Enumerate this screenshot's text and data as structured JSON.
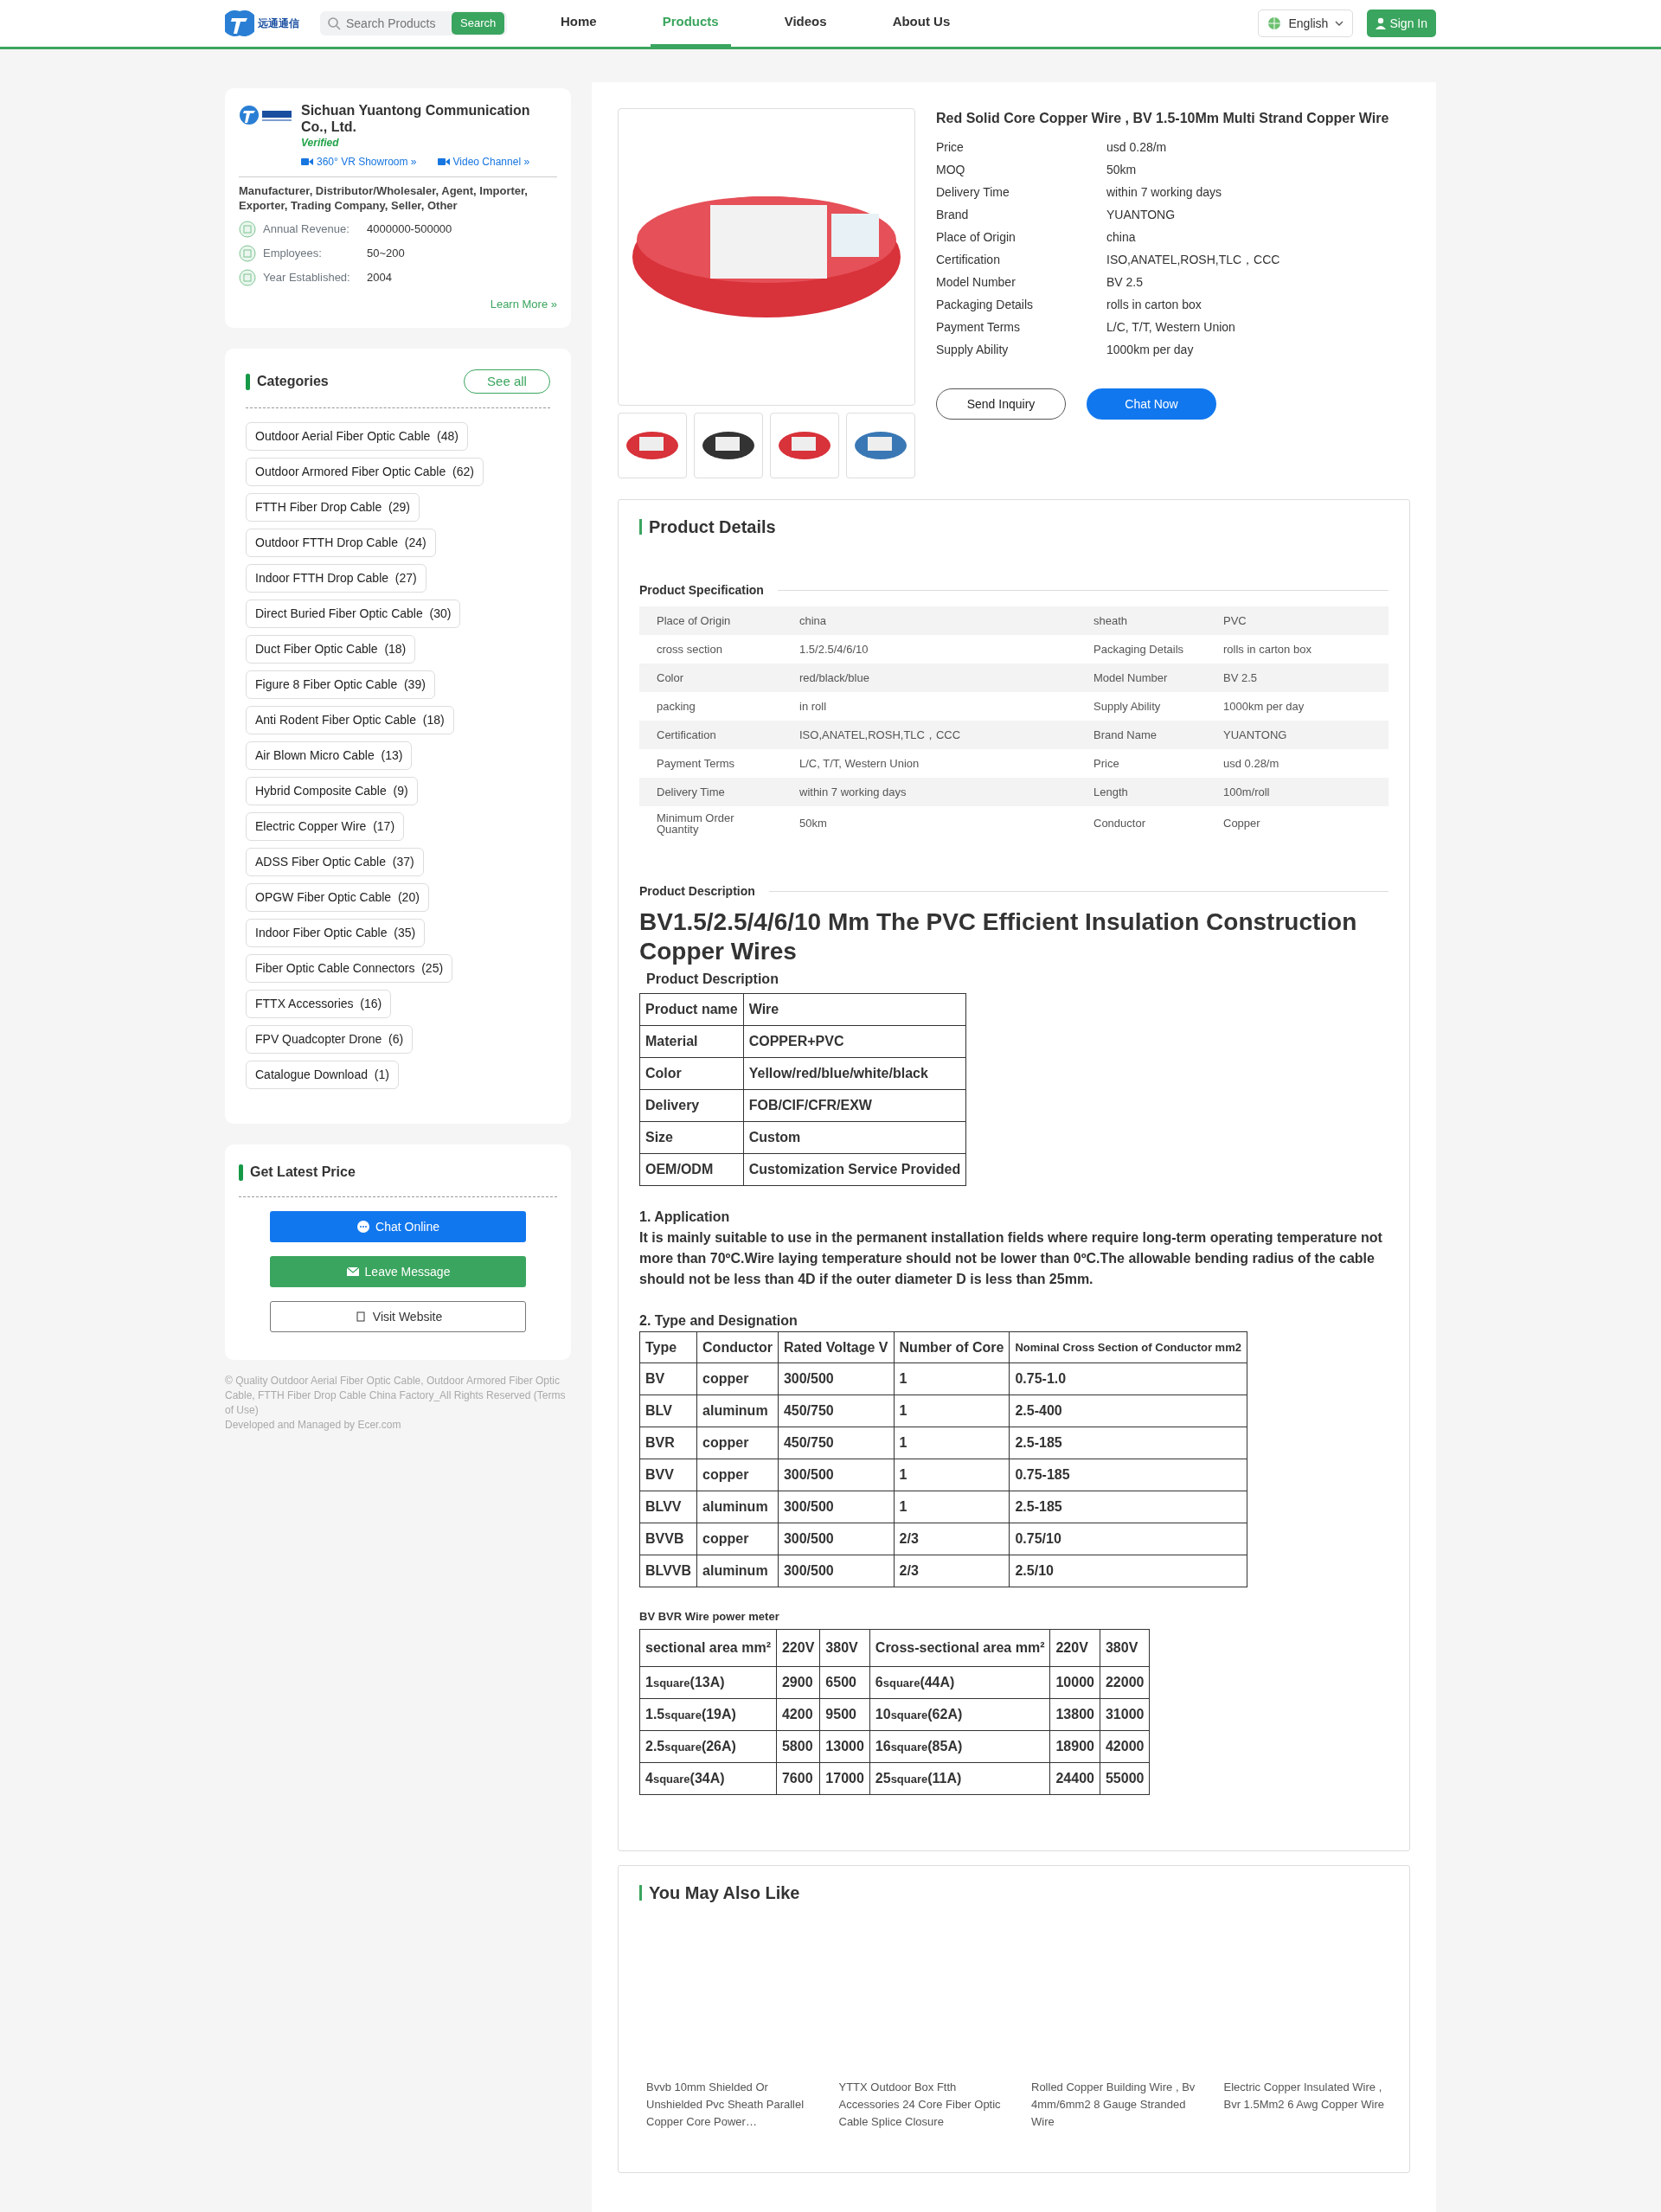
{
  "header": {
    "logo_text": "远通通信",
    "search_placeholder": "Search Products",
    "search_button": "Search",
    "nav": [
      {
        "label": "Home",
        "selected": false
      },
      {
        "label": "Products",
        "selected": true
      },
      {
        "label": "Videos",
        "selected": false
      },
      {
        "label": "About Us",
        "selected": false
      }
    ],
    "language": "English",
    "sign_in": "Sign In"
  },
  "company": {
    "name": "Sichuan Yuantong Communication Co., Ltd.",
    "verified": "Verified",
    "links": [
      "360° VR Showroom »",
      "Video Channel »"
    ],
    "business_types": "Manufacturer, Distributor/Wholesaler, Agent, Importer, Exporter, Trading Company, Seller, Other",
    "facts": [
      {
        "label": "Annual Revenue:",
        "value": "4000000-500000"
      },
      {
        "label": "Employees:",
        "value": "50~200"
      },
      {
        "label": "Year Established:",
        "value": "2004"
      }
    ],
    "learn_more": "Learn More »"
  },
  "categories": {
    "title": "Categories",
    "see_all": "See all",
    "items": [
      {
        "name": "Outdoor Aerial Fiber Optic Cable",
        "count": "(48)"
      },
      {
        "name": "Outdoor Armored Fiber Optic Cable",
        "count": "(62)"
      },
      {
        "name": "FTTH Fiber Drop Cable",
        "count": "(29)"
      },
      {
        "name": "Outdoor FTTH Drop Cable",
        "count": "(24)"
      },
      {
        "name": "Indoor FTTH Drop Cable",
        "count": "(27)"
      },
      {
        "name": "Direct Buried Fiber Optic Cable",
        "count": "(30)"
      },
      {
        "name": "Duct Fiber Optic Cable",
        "count": "(18)"
      },
      {
        "name": "Figure 8 Fiber Optic Cable",
        "count": "(39)"
      },
      {
        "name": "Anti Rodent Fiber Optic Cable",
        "count": "(18)"
      },
      {
        "name": "Air Blown Micro Cable",
        "count": "(13)"
      },
      {
        "name": "Hybrid Composite Cable",
        "count": "(9)"
      },
      {
        "name": "Electric Copper Wire",
        "count": "(17)"
      },
      {
        "name": "ADSS Fiber Optic Cable",
        "count": "(37)"
      },
      {
        "name": "OPGW Fiber Optic Cable",
        "count": "(20)"
      },
      {
        "name": "Indoor Fiber Optic Cable",
        "count": "(35)"
      },
      {
        "name": "Fiber Optic Cable Connectors",
        "count": "(25)"
      },
      {
        "name": "FTTX Accessories",
        "count": "(16)"
      },
      {
        "name": "FPV Quadcopter Drone",
        "count": "(6)"
      },
      {
        "name": "Catalogue Download",
        "count": "(1)"
      }
    ]
  },
  "latest_price": {
    "title": "Get Latest Price",
    "buttons": [
      {
        "label": "Chat Online",
        "kind": "chat"
      },
      {
        "label": "Leave Message",
        "kind": "message"
      },
      {
        "label": "Visit Website",
        "kind": "website"
      }
    ]
  },
  "footer": {
    "copyright": "© Quality Outdoor Aerial Fiber Optic Cable, Outdoor Armored Fiber Optic Cable, FTTH Fiber Drop Cable China Factory_All Rights Reserved (Terms of Use)",
    "developed": "Developed and Managed by Ecer.com"
  },
  "product": {
    "title": "Red Solid Core Copper Wire , BV 1.5-10Mm Multi Strand Copper Wire",
    "attributes": [
      {
        "label": "Price",
        "value": "usd 0.28/m"
      },
      {
        "label": "MOQ",
        "value": "50km"
      },
      {
        "label": "Delivery Time",
        "value": "within 7 working days"
      },
      {
        "label": "Brand",
        "value": "YUANTONG"
      },
      {
        "label": "Place of Origin",
        "value": "china"
      },
      {
        "label": "Certification",
        "value": "ISO,ANATEL,ROSH,TLC，CCC"
      },
      {
        "label": "Model Number",
        "value": "BV 2.5"
      },
      {
        "label": "Packaging Details",
        "value": "rolls in carton box"
      },
      {
        "label": "Payment Terms",
        "value": "L/C, T/T, Western Union"
      },
      {
        "label": "Supply Ability",
        "value": "1000km per day"
      }
    ],
    "buttons": [
      {
        "label": "Send Inquiry",
        "kind": "outline"
      },
      {
        "label": "Chat Now",
        "kind": "primary"
      }
    ]
  },
  "details": {
    "title": "Product Details",
    "spec_title": "Product Specification",
    "spec_rows": [
      [
        "Place of Origin",
        "china",
        "sheath",
        "PVC"
      ],
      [
        "cross section",
        "1.5/2.5/4/6/10",
        "Packaging Details",
        "rolls in carton box"
      ],
      [
        "Color",
        "red/black/blue",
        "Model Number",
        "BV 2.5"
      ],
      [
        "packing",
        "in roll",
        "Supply Ability",
        "1000km per day"
      ],
      [
        "Certification",
        "ISO,ANATEL,ROSH,TLC，CCC",
        "Brand Name",
        "YUANTONG"
      ],
      [
        "Payment Terms",
        "L/C, T/T, Western Union",
        "Price",
        "usd 0.28/m"
      ],
      [
        "Delivery Time",
        "within 7 working days",
        "Length",
        "100m/roll"
      ],
      [
        "Minimum Order Quantity",
        "50km",
        "Conductor",
        "Copper"
      ]
    ],
    "desc_title": "Product Description",
    "heading": "BV1.5/2.5/4/6/10 Mm The PVC Efficient Insulation Construction Copper Wires",
    "sub_heading": "Product Description",
    "info_rows": [
      [
        "Product name",
        "Wire"
      ],
      [
        "Material",
        "COPPER+PVC"
      ],
      [
        "Color",
        "Yellow/red/blue/white/black"
      ],
      [
        "Delivery",
        "FOB/CIF/CFR/EXW"
      ],
      [
        "Size",
        "Custom"
      ],
      [
        "OEM/ODM",
        "Customization Service Provided"
      ]
    ],
    "application_title": "1. Application",
    "application_text": "It is mainly suitable to use in the permanent installation fields where require long-term operating temperature not more than 70ºC.Wire laying temperature should not be lower than 0ºC.The allowable bending radius of the cable should not be less than 4D if the outer diameter D is less than 25mm.",
    "type_title": "2. Type and Designation",
    "type_header": [
      "Type",
      "Conductor",
      "Rated Voltage V",
      "Number of Core",
      "Nominal Cross Section of Conductor mm2"
    ],
    "type_rows": [
      [
        "BV",
        "copper",
        "300/500",
        "1",
        "0.75-1.0"
      ],
      [
        "BLV",
        "aluminum",
        "450/750",
        "1",
        "2.5-400"
      ],
      [
        "BVR",
        "copper",
        "450/750",
        "1",
        "2.5-185"
      ],
      [
        "BVV",
        "copper",
        "300/500",
        "1",
        "0.75-185"
      ],
      [
        "BLVV",
        "aluminum",
        "300/500",
        "1",
        "2.5-185"
      ],
      [
        "BVVB",
        "copper",
        "300/500",
        "2/3",
        "0.75/10"
      ],
      [
        "BLVVB",
        "aluminum",
        "300/500",
        "2/3",
        "2.5/10"
      ]
    ],
    "power_title": "BV BVR Wire power meter",
    "power_header": [
      "sectional area mm²",
      "220V",
      "380V",
      "Cross-sectional area mm²",
      "220V",
      "380V"
    ],
    "power_rows": [
      [
        {
          "num": "1",
          "unit": "square",
          "amp": "(13A)"
        },
        "2900",
        "6500",
        {
          "num": "6",
          "unit": "square",
          "amp": "(44A)"
        },
        "10000",
        "22000"
      ],
      [
        {
          "num": "1.5",
          "unit": "square",
          "amp": "(19A)"
        },
        "4200",
        "9500",
        {
          "num": "10",
          "unit": "square",
          "amp": "(62A)"
        },
        "13800",
        "31000"
      ],
      [
        {
          "num": "2.5",
          "unit": "square",
          "amp": "(26A)"
        },
        "5800",
        "13000",
        {
          "num": "16",
          "unit": "square",
          "amp": "(85A)"
        },
        "18900",
        "42000"
      ],
      [
        {
          "num": "4",
          "unit": "square",
          "amp": "(34A)"
        },
        "7600",
        "17000",
        {
          "num": "25",
          "unit": "square",
          "amp": "(11A)"
        },
        "24400",
        "55000"
      ]
    ]
  },
  "related": {
    "title": "You May Also Like",
    "items": [
      "Bvvb 10mm Shielded Or Unshielded Pvc Sheath Parallel Copper Core Power…",
      "YTTX Outdoor Box Ftth Accessories 24 Core Fiber Optic Cable Splice Closure",
      "Rolled Copper Building Wire , Bv 4mm/6mm2 8 Gauge Stranded Wire",
      "Electric Copper Insulated Wire , Bvr 1.5Mm2 6 Awg Copper Wire"
    ]
  }
}
